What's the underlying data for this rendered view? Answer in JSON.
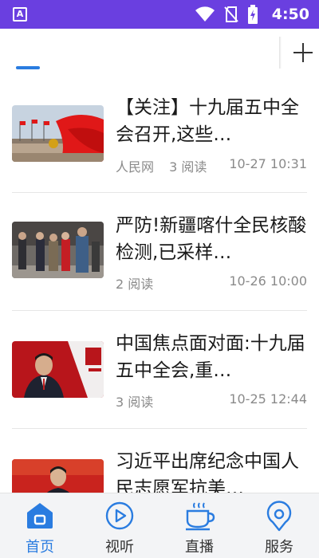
{
  "status_bar": {
    "app_badge": "A",
    "time": "4:50"
  },
  "accent_color": "#2a7ce0",
  "status_bar_color": "#6a3fe0",
  "articles": [
    {
      "title": "【关注】十九届五中全会召开,这些…",
      "source": "人民网",
      "reads": "3 阅读",
      "date": "10-27 10:31",
      "thumb": "flag-building-photo"
    },
    {
      "title": "严防!新疆喀什全民核酸检测,已采样…",
      "source": "",
      "reads": "2 阅读",
      "date": "10-26 10:00",
      "thumb": "street-crowd-photo"
    },
    {
      "title": "中国焦点面对面:十九届五中全会,重…",
      "source": "",
      "reads": "3 阅读",
      "date": "10-25 12:44",
      "thumb": "speaker-red-backdrop-photo"
    },
    {
      "title": "习近平出席纪念中国人民志愿军抗美…",
      "source": "",
      "reads": "",
      "date": "",
      "thumb": "leader-red-backdrop-photo"
    }
  ],
  "bottom_nav": {
    "items": [
      {
        "label": "首页",
        "icon": "home-icon",
        "active": true
      },
      {
        "label": "视听",
        "icon": "play-icon",
        "active": false
      },
      {
        "label": "直播",
        "icon": "cup-icon",
        "active": false
      },
      {
        "label": "服务",
        "icon": "location-pin-icon",
        "active": false
      }
    ]
  }
}
